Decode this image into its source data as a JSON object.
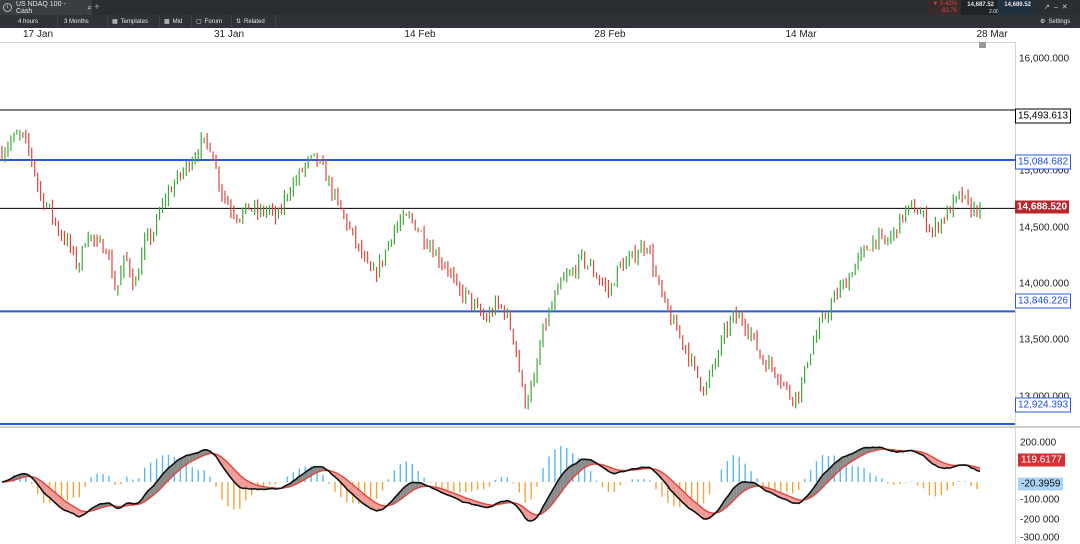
{
  "tab": {
    "title": "US NDAQ 100 - Cash",
    "icon": "search-icon"
  },
  "quote": {
    "change": "0.42%",
    "change_points": "62.76",
    "sell": "14,687.52",
    "buy": "14,689.52",
    "spread": "2.00"
  },
  "toolbar": {
    "interval": "4 hours",
    "range": "3 Months",
    "templates": "Templates",
    "price_type": "Mid",
    "forum": "Forum",
    "related": "Related",
    "settings": "Settings"
  },
  "dates": [
    "17 Jan",
    "31 Jan",
    "14 Feb",
    "28 Feb",
    "14 Mar",
    "28 Mar"
  ],
  "price_axis": [
    "16,000.000",
    "15,000.000",
    "14,500.000",
    "14,000.000",
    "13,500.000",
    "13,000.000"
  ],
  "levels": {
    "l1": "15,493.613",
    "l2": "15,084.682",
    "current": "14,688.520",
    "l3": "13,846.226",
    "l4": "12,924.393"
  },
  "indicator": {
    "labels": [
      "200.000",
      "-100.000",
      "-200 000",
      "-300.000"
    ],
    "macd_value": "119.6177",
    "hist_value": "-20.3959"
  },
  "colors": {
    "up": "#3ea83a",
    "down": "#e0453d",
    "level": "#2a5bd7"
  },
  "chart_data": {
    "type": "candlestick",
    "x": [
      "17 Jan",
      "31 Jan",
      "14 Feb",
      "28 Feb",
      "14 Mar",
      "28 Mar"
    ],
    "ylim": [
      12900,
      16050
    ],
    "horizontal_lines": [
      15493.613,
      15084.682,
      14688.52,
      13846.226,
      12924.393
    ],
    "last": 14688.52,
    "path": [
      15150,
      15250,
      15290,
      15130,
      14800,
      14680,
      14500,
      14400,
      14200,
      14500,
      14380,
      14380,
      14000,
      14300,
      14050,
      14400,
      14500,
      14750,
      14880,
      14980,
      15100,
      15220,
      15200,
      14850,
      14700,
      14620,
      14700,
      14650,
      14680,
      14600,
      14820,
      14920,
      15050,
      15100,
      14980,
      14780,
      14620,
      14450,
      14280,
      14130,
      14250,
      14480,
      14580,
      14610,
      14500,
      14400,
      14280,
      14200,
      14000,
      13980,
      13850,
      13780,
      13900,
      13850,
      13600,
      13100,
      13250,
      13700,
      13900,
      14100,
      14150,
      14280,
      14200,
      14100,
      14000,
      14220,
      14250,
      14350,
      14400,
      14080,
      13850,
      13700,
      13550,
      13350,
      13200,
      13400,
      13650,
      13800,
      13780,
      13650,
      13450,
      13400,
      13300,
      13150,
      13180,
      13500,
      13700,
      13850,
      14000,
      14100,
      14250,
      14350,
      14450,
      14400,
      14500,
      14650,
      14700,
      14620,
      14500,
      14600,
      14700,
      14800,
      14680,
      14688.52
    ]
  }
}
